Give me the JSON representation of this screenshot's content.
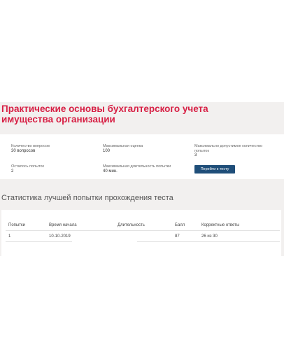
{
  "course": {
    "title": "Практические основы бухгалтерского учета имущества организации"
  },
  "info": {
    "questions_count": {
      "label": "Количество вопросов",
      "value": "30 вопросов"
    },
    "max_score": {
      "label": "Максимальная оценка",
      "value": "100"
    },
    "max_attempts": {
      "label": "Максимально допустимое количество попыток",
      "value": "3"
    },
    "attempts_left": {
      "label": "Осталось попыток",
      "value": "2"
    },
    "max_duration": {
      "label": "Максимальная длительность попытки",
      "value": "40 мин."
    },
    "start_button": "Перейти к тесту"
  },
  "stats": {
    "title": "Статистика лучшей попытки прохождения теста",
    "columns": [
      "Попытки",
      "Время начала",
      "Длительность",
      "Балл",
      "Корректные ответы"
    ],
    "rows": [
      [
        "1",
        "10-10-2019",
        "",
        "87",
        "26 из 30"
      ]
    ]
  }
}
